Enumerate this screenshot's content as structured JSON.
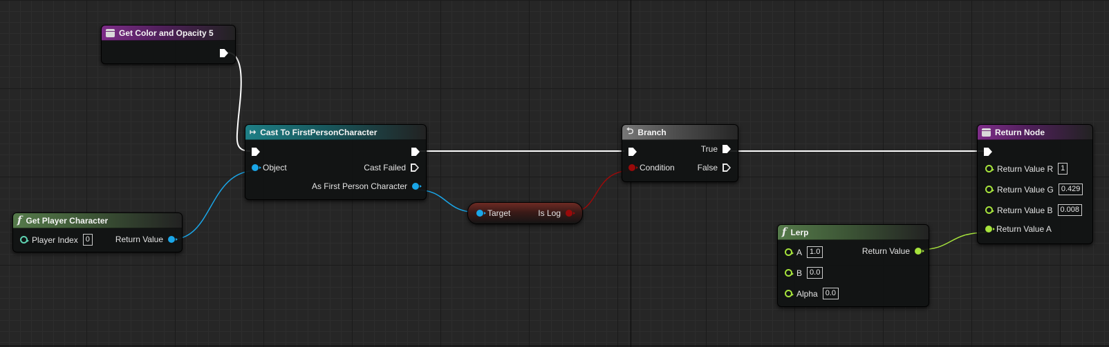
{
  "nodes": {
    "get_color": {
      "title": "Get Color and Opacity 5"
    },
    "cast": {
      "title": "Cast To FirstPersonCharacter",
      "object_label": "Object",
      "cast_failed_label": "Cast Failed",
      "as_fpc_label": "As First Person Character"
    },
    "get_player": {
      "title": "Get Player Character",
      "player_index_label": "Player Index",
      "player_index_value": "0",
      "return_label": "Return Value"
    },
    "is_valid": {
      "target_label": "Target",
      "is_log_label": "Is Log"
    },
    "branch": {
      "title": "Branch",
      "condition_label": "Condition",
      "true_label": "True",
      "false_label": "False"
    },
    "lerp": {
      "title": "Lerp",
      "a_label": "A",
      "a_value": "1.0",
      "b_label": "B",
      "b_value": "0.0",
      "alpha_label": "Alpha",
      "alpha_value": "0.0",
      "return_label": "Return Value"
    },
    "return_node": {
      "title": "Return Node",
      "r_label": "Return Value R",
      "r_value": "1",
      "g_label": "Return Value G",
      "g_value": "0.429",
      "b_label": "Return Value B",
      "b_value": "0.008",
      "a_label": "Return Value A"
    }
  },
  "colors": {
    "exec_wire": "#ffffff",
    "object_wire": "#1aa6e8",
    "bool_wire": "#9a0a0a",
    "float_wire": "#a6e33c",
    "graph_background": "#262626"
  }
}
